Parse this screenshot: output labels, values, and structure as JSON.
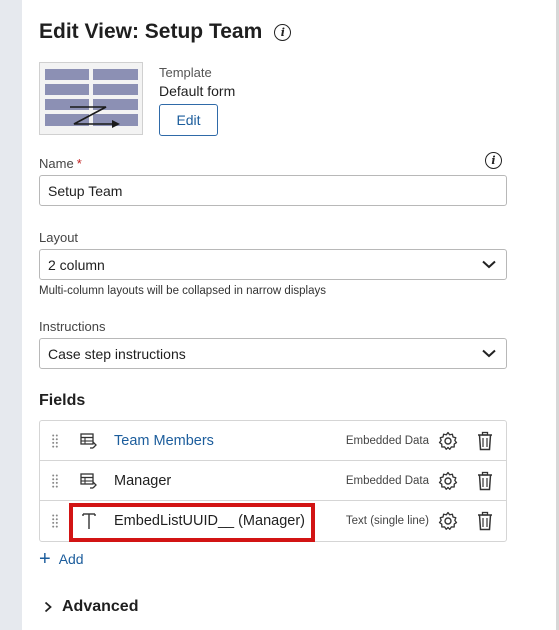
{
  "header": {
    "title": "Edit View: Setup Team",
    "info_icon": "info-icon"
  },
  "template": {
    "label": "Template",
    "value": "Default form",
    "edit_label": "Edit"
  },
  "name_field": {
    "label": "Name",
    "required_mark": "*",
    "value": "Setup Team"
  },
  "layout_field": {
    "label": "Layout",
    "value": "2 column",
    "hint": "Multi-column layouts will be collapsed in narrow displays"
  },
  "instructions_field": {
    "label": "Instructions",
    "value": "Case step instructions"
  },
  "fields": {
    "title": "Fields",
    "items": [
      {
        "name": "Team Members",
        "kind": "Embedded Data",
        "icon": "embedded-data-icon"
      },
      {
        "name": "Manager",
        "kind": "Embedded Data",
        "icon": "embedded-data-icon"
      },
      {
        "name": "EmbedListUUID__ (Manager)",
        "kind": "Text (single line)",
        "icon": "text-icon"
      }
    ],
    "add_label": "Add"
  },
  "advanced": {
    "label": "Advanced"
  },
  "colors": {
    "link": "#1c5d9c",
    "highlight": "#d21414",
    "required": "#c02020"
  }
}
